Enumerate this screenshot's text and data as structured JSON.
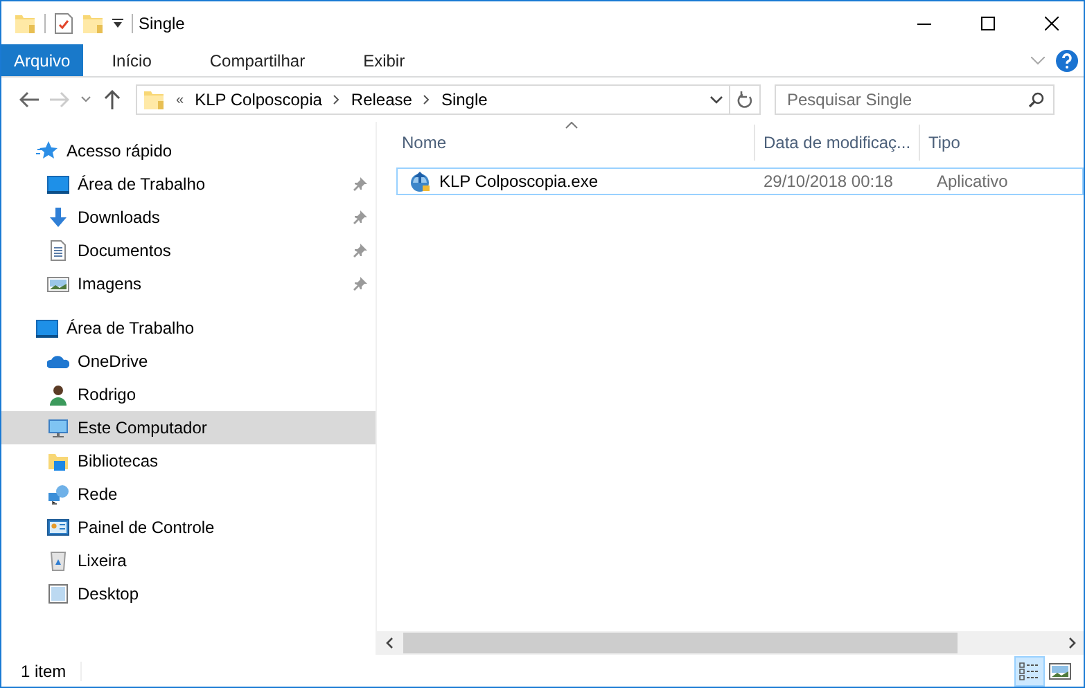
{
  "window": {
    "title": "Single"
  },
  "ribbon_tabs": [
    {
      "label": "Arquivo",
      "kind": "file",
      "selected": false
    },
    {
      "label": "Início",
      "kind": "tab",
      "selected": false
    },
    {
      "label": "Compartilhar",
      "kind": "tab",
      "selected": false
    },
    {
      "label": "Exibir",
      "kind": "tab",
      "selected": false
    }
  ],
  "address_bar": {
    "overflow": "«",
    "path": [
      "KLP Colposcopia",
      "Release",
      "Single"
    ]
  },
  "search": {
    "placeholder": "Pesquisar Single"
  },
  "navigation": [
    {
      "label": "Acesso rápido",
      "kind": "quick-access",
      "selected": false,
      "children": [
        {
          "label": "Área de Trabalho",
          "kind": "desktop",
          "selected": false,
          "pinned": true
        },
        {
          "label": "Downloads",
          "kind": "download",
          "selected": false,
          "pinned": true
        },
        {
          "label": "Documentos",
          "kind": "documents",
          "selected": false,
          "pinned": true
        },
        {
          "label": "Imagens",
          "kind": "images",
          "selected": false,
          "pinned": true
        }
      ]
    },
    {
      "label": "Área de Trabalho",
      "kind": "desktop",
      "selected": false,
      "children": [
        {
          "label": "OneDrive",
          "kind": "onedrive",
          "selected": false,
          "pinned": false
        },
        {
          "label": "Rodrigo",
          "kind": "user",
          "selected": false,
          "pinned": false
        },
        {
          "label": "Este Computador",
          "kind": "computer",
          "selected": true,
          "pinned": false
        },
        {
          "label": "Bibliotecas",
          "kind": "libraries",
          "selected": false,
          "pinned": false
        },
        {
          "label": "Rede",
          "kind": "network",
          "selected": false,
          "pinned": false
        },
        {
          "label": "Painel de Controle",
          "kind": "control-panel",
          "selected": false,
          "pinned": false
        },
        {
          "label": "Lixeira",
          "kind": "recycle-bin",
          "selected": false,
          "pinned": false
        },
        {
          "label": "Desktop",
          "kind": "folder",
          "selected": false,
          "pinned": false
        }
      ]
    }
  ],
  "file_list": {
    "columns": [
      "Nome",
      "Data de modificaç...",
      "Tipo"
    ],
    "rows": [
      {
        "name": "KLP Colposcopia.exe",
        "date": "29/10/2018 00:18",
        "type": "Aplicativo",
        "selected": false,
        "focused": true
      }
    ]
  },
  "status_bar": {
    "text": "1 item",
    "views": [
      {
        "kind": "details",
        "selected": true
      },
      {
        "kind": "large-icons",
        "selected": false
      }
    ]
  }
}
